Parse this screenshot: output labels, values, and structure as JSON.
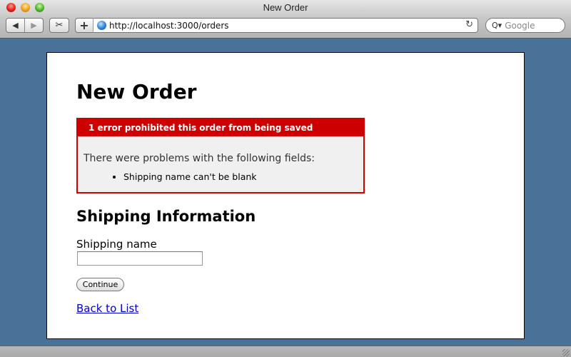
{
  "window": {
    "title": "New Order",
    "url": "http://localhost:3000/orders",
    "search_placeholder": "Google"
  },
  "toolbar": {
    "back_glyph": "◀",
    "forward_glyph": "▶",
    "snip_glyph": "✂",
    "add_glyph": "+",
    "reload_glyph": "↻",
    "search_glyph": "Q▾"
  },
  "page": {
    "heading": "New Order",
    "error": {
      "title": "1 error prohibited this order from being saved",
      "intro": "There were problems with the following fields:",
      "messages": [
        "Shipping name can't be blank"
      ],
      "color": "#cc0000"
    },
    "section_heading": "Shipping Information",
    "form": {
      "shipping_name_label": "Shipping name",
      "shipping_name_value": "",
      "submit_label": "Continue"
    },
    "back_link": "Back to List"
  }
}
